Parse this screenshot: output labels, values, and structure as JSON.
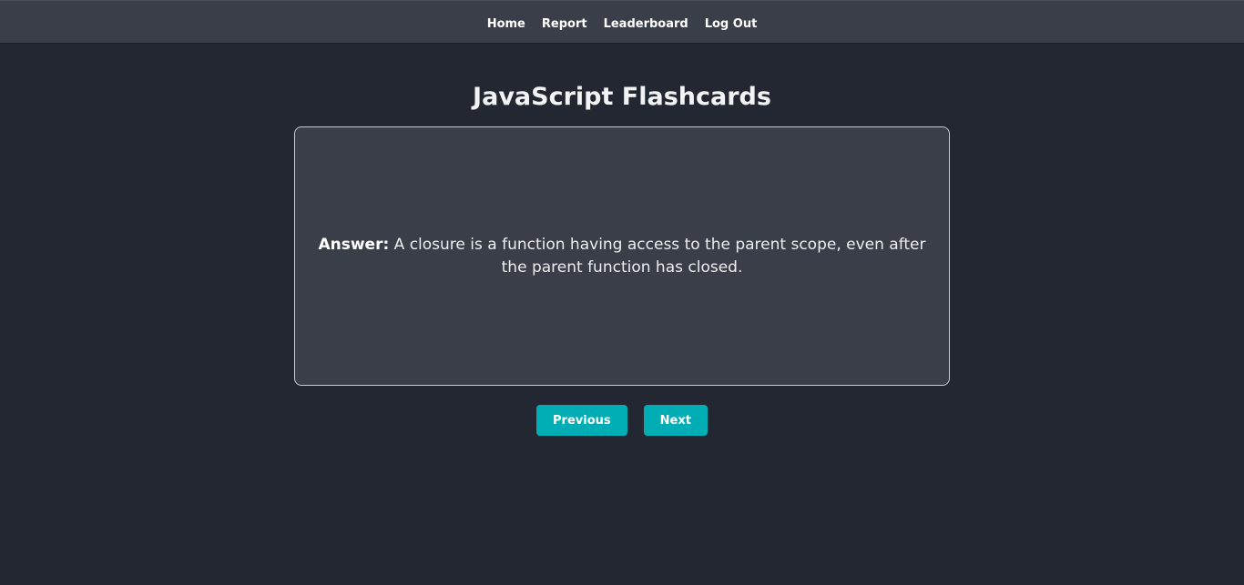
{
  "nav": {
    "items": [
      {
        "label": "Home"
      },
      {
        "label": "Report"
      },
      {
        "label": "Leaderboard"
      },
      {
        "label": "Log Out"
      }
    ]
  },
  "page": {
    "title": "JavaScript Flashcards"
  },
  "card": {
    "label": "Answer:",
    "text": " A closure is a function having access to the parent scope, even after the parent function has closed."
  },
  "controls": {
    "previous_label": "Previous",
    "next_label": "Next"
  },
  "colors": {
    "background": "#222731",
    "navbar": "#3a3e48",
    "card": "#3a3e48",
    "accent": "#00adb5"
  }
}
